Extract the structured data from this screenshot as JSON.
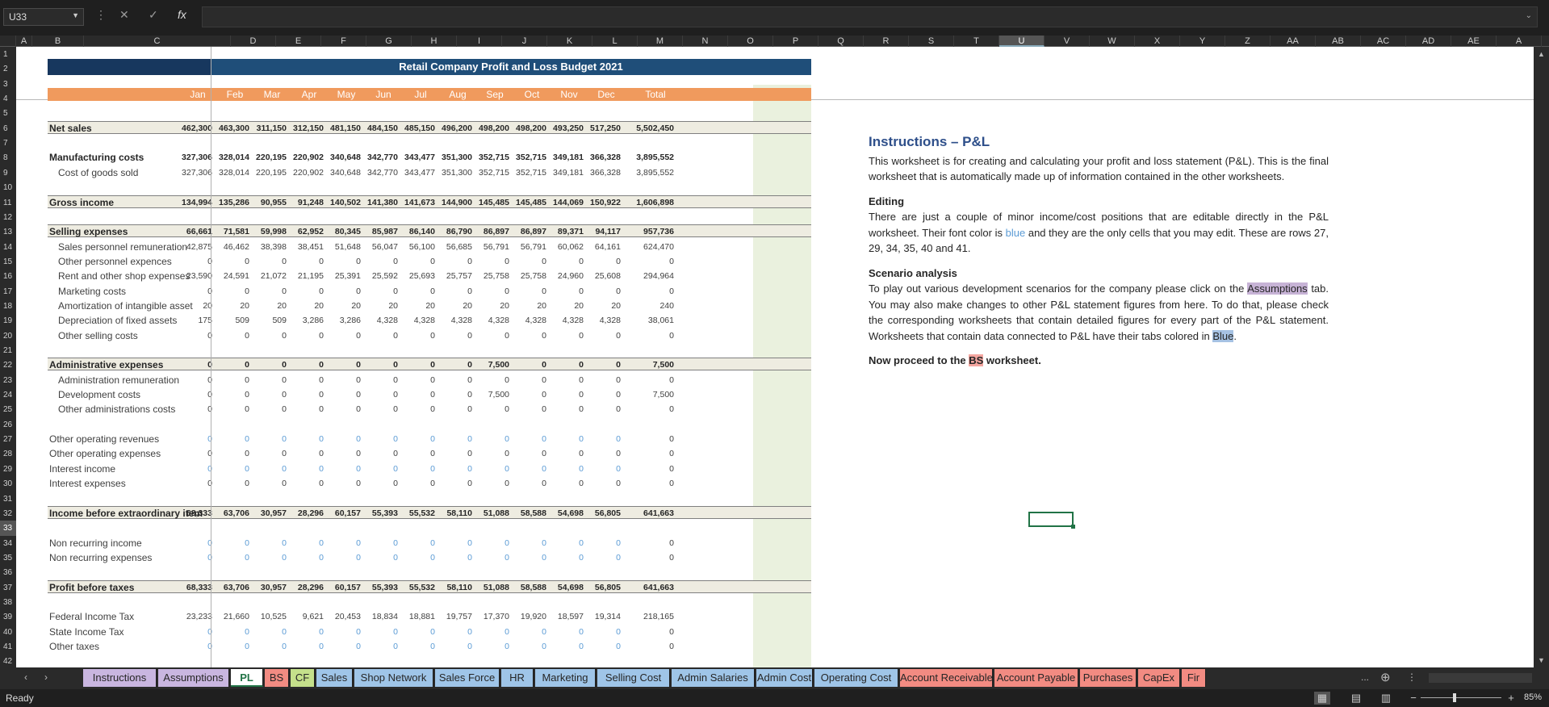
{
  "formula_bar": {
    "name_box": "U33",
    "cancel_icon": "✕",
    "enter_icon": "✓",
    "fx_label": "fx",
    "formula": ""
  },
  "columns": [
    "A",
    "B",
    "C",
    "D",
    "E",
    "F",
    "G",
    "H",
    "I",
    "J",
    "K",
    "L",
    "M",
    "N",
    "O",
    "P",
    "Q",
    "R",
    "S",
    "T",
    "U",
    "V",
    "W",
    "X",
    "Y",
    "Z",
    "AA",
    "AB",
    "AC",
    "AD",
    "AE",
    "A"
  ],
  "selected_column": "U",
  "rows": [
    "1",
    "2",
    "3",
    "4",
    "5",
    "6",
    "7",
    "8",
    "9",
    "10",
    "11",
    "12",
    "13",
    "14",
    "15",
    "16",
    "17",
    "18",
    "19",
    "20",
    "21",
    "22",
    "23",
    "24",
    "25",
    "26",
    "27",
    "28",
    "29",
    "30",
    "31",
    "32",
    "33",
    "34",
    "35",
    "36",
    "37",
    "38",
    "39",
    "40",
    "41",
    "42"
  ],
  "selected_row": "33",
  "sheet": {
    "title": "Retail Company Profit and Loss Budget 2021",
    "months": [
      "Jan",
      "Feb",
      "Mar",
      "Apr",
      "May",
      "Jun",
      "Jul",
      "Aug",
      "Sep",
      "Oct",
      "Nov",
      "Dec",
      "Total"
    ],
    "lines": [
      {
        "row": 6,
        "label": "Net sales",
        "style": "band",
        "values": [
          "462,300",
          "463,300",
          "311,150",
          "312,150",
          "481,150",
          "484,150",
          "485,150",
          "496,200",
          "498,200",
          "498,200",
          "493,250",
          "517,250",
          "5,502,450"
        ]
      },
      {
        "row": 8,
        "label": "Manufacturing costs",
        "style": "bold",
        "values": [
          "327,306",
          "328,014",
          "220,195",
          "220,902",
          "340,648",
          "342,770",
          "343,477",
          "351,300",
          "352,715",
          "352,715",
          "349,181",
          "366,328",
          "3,895,552"
        ]
      },
      {
        "row": 9,
        "label": "Cost of goods sold",
        "style": "sub",
        "values": [
          "327,306",
          "328,014",
          "220,195",
          "220,902",
          "340,648",
          "342,770",
          "343,477",
          "351,300",
          "352,715",
          "352,715",
          "349,181",
          "366,328",
          "3,895,552"
        ]
      },
      {
        "row": 11,
        "label": "Gross income",
        "style": "band",
        "values": [
          "134,994",
          "135,286",
          "90,955",
          "91,248",
          "140,502",
          "141,380",
          "141,673",
          "144,900",
          "145,485",
          "145,485",
          "144,069",
          "150,922",
          "1,606,898"
        ]
      },
      {
        "row": 13,
        "label": "Selling expenses",
        "style": "band",
        "values": [
          "66,661",
          "71,581",
          "59,998",
          "62,952",
          "80,345",
          "85,987",
          "86,140",
          "86,790",
          "86,897",
          "86,897",
          "89,371",
          "94,117",
          "957,736"
        ]
      },
      {
        "row": 14,
        "label": "Sales personnel remuneration",
        "style": "sub",
        "values": [
          "42,875",
          "46,462",
          "38,398",
          "38,451",
          "51,648",
          "56,047",
          "56,100",
          "56,685",
          "56,791",
          "56,791",
          "60,062",
          "64,161",
          "624,470"
        ]
      },
      {
        "row": 15,
        "label": "Other personnel expences",
        "style": "sub",
        "values": [
          "0",
          "0",
          "0",
          "0",
          "0",
          "0",
          "0",
          "0",
          "0",
          "0",
          "0",
          "0",
          "0"
        ]
      },
      {
        "row": 16,
        "label": "Rent and other shop expenses",
        "style": "sub",
        "values": [
          "23,590",
          "24,591",
          "21,072",
          "21,195",
          "25,391",
          "25,592",
          "25,693",
          "25,757",
          "25,758",
          "25,758",
          "24,960",
          "25,608",
          "294,964"
        ]
      },
      {
        "row": 17,
        "label": "Marketing costs",
        "style": "sub",
        "values": [
          "0",
          "0",
          "0",
          "0",
          "0",
          "0",
          "0",
          "0",
          "0",
          "0",
          "0",
          "0",
          "0"
        ]
      },
      {
        "row": 18,
        "label": "Amortization of intangible asset",
        "style": "sub",
        "values": [
          "20",
          "20",
          "20",
          "20",
          "20",
          "20",
          "20",
          "20",
          "20",
          "20",
          "20",
          "20",
          "240"
        ]
      },
      {
        "row": 19,
        "label": "Depreciation of fixed assets",
        "style": "sub",
        "values": [
          "175",
          "509",
          "509",
          "3,286",
          "3,286",
          "4,328",
          "4,328",
          "4,328",
          "4,328",
          "4,328",
          "4,328",
          "4,328",
          "38,061"
        ]
      },
      {
        "row": 20,
        "label": "Other selling costs",
        "style": "sub",
        "values": [
          "0",
          "0",
          "0",
          "0",
          "0",
          "0",
          "0",
          "0",
          "0",
          "0",
          "0",
          "0",
          "0"
        ]
      },
      {
        "row": 22,
        "label": "Administrative expenses",
        "style": "band",
        "values": [
          "0",
          "0",
          "0",
          "0",
          "0",
          "0",
          "0",
          "0",
          "7,500",
          "0",
          "0",
          "0",
          "7,500"
        ]
      },
      {
        "row": 23,
        "label": "Administration remuneration",
        "style": "sub",
        "values": [
          "0",
          "0",
          "0",
          "0",
          "0",
          "0",
          "0",
          "0",
          "0",
          "0",
          "0",
          "0",
          "0"
        ]
      },
      {
        "row": 24,
        "label": "Development costs",
        "style": "sub",
        "values": [
          "0",
          "0",
          "0",
          "0",
          "0",
          "0",
          "0",
          "0",
          "7,500",
          "0",
          "0",
          "0",
          "7,500"
        ]
      },
      {
        "row": 25,
        "label": "Other administrations costs",
        "style": "sub",
        "values": [
          "0",
          "0",
          "0",
          "0",
          "0",
          "0",
          "0",
          "0",
          "0",
          "0",
          "0",
          "0",
          "0"
        ]
      },
      {
        "row": 27,
        "label": "Other operating revenues",
        "style": "blue",
        "values": [
          "0",
          "0",
          "0",
          "0",
          "0",
          "0",
          "0",
          "0",
          "0",
          "0",
          "0",
          "0",
          "0"
        ]
      },
      {
        "row": 28,
        "label": "Other operating expenses",
        "style": "plain",
        "values": [
          "0",
          "0",
          "0",
          "0",
          "0",
          "0",
          "0",
          "0",
          "0",
          "0",
          "0",
          "0",
          "0"
        ]
      },
      {
        "row": 29,
        "label": "Interest income",
        "style": "blue",
        "values": [
          "0",
          "0",
          "0",
          "0",
          "0",
          "0",
          "0",
          "0",
          "0",
          "0",
          "0",
          "0",
          "0"
        ]
      },
      {
        "row": 30,
        "label": "Interest expenses",
        "style": "plain",
        "values": [
          "0",
          "0",
          "0",
          "0",
          "0",
          "0",
          "0",
          "0",
          "0",
          "0",
          "0",
          "0",
          "0"
        ]
      },
      {
        "row": 32,
        "label": "Income before extraordinary item",
        "style": "band",
        "values": [
          "68,333",
          "63,706",
          "30,957",
          "28,296",
          "60,157",
          "55,393",
          "55,532",
          "58,110",
          "51,088",
          "58,588",
          "54,698",
          "56,805",
          "641,663"
        ]
      },
      {
        "row": 34,
        "label": "Non recurring income",
        "style": "blue",
        "values": [
          "0",
          "0",
          "0",
          "0",
          "0",
          "0",
          "0",
          "0",
          "0",
          "0",
          "0",
          "0",
          "0"
        ]
      },
      {
        "row": 35,
        "label": "Non recurring expenses",
        "style": "blue",
        "values": [
          "0",
          "0",
          "0",
          "0",
          "0",
          "0",
          "0",
          "0",
          "0",
          "0",
          "0",
          "0",
          "0"
        ]
      },
      {
        "row": 37,
        "label": "Profit before taxes",
        "style": "band",
        "values": [
          "68,333",
          "63,706",
          "30,957",
          "28,296",
          "60,157",
          "55,393",
          "55,532",
          "58,110",
          "51,088",
          "58,588",
          "54,698",
          "56,805",
          "641,663"
        ]
      },
      {
        "row": 39,
        "label": "Federal Income Tax",
        "style": "plain",
        "values": [
          "23,233",
          "21,660",
          "10,525",
          "9,621",
          "20,453",
          "18,834",
          "18,881",
          "19,757",
          "17,370",
          "19,920",
          "18,597",
          "19,314",
          "218,165"
        ]
      },
      {
        "row": 40,
        "label": "State Income Tax",
        "style": "blue",
        "values": [
          "0",
          "0",
          "0",
          "0",
          "0",
          "0",
          "0",
          "0",
          "0",
          "0",
          "0",
          "0",
          "0"
        ]
      },
      {
        "row": 41,
        "label": "Other taxes",
        "style": "blue",
        "values": [
          "0",
          "0",
          "0",
          "0",
          "0",
          "0",
          "0",
          "0",
          "0",
          "0",
          "0",
          "0",
          "0"
        ]
      }
    ]
  },
  "instructions": {
    "title": "Instructions – P&L",
    "intro": "This worksheet is for creating and calculating your profit and loss statement (P&L). This is the final worksheet that is automatically made up of information contained in the other worksheets.",
    "editing_heading": "Editing",
    "editing_p1": "There are just a couple of minor income/cost positions that are editable directly in the P&L worksheet. Their font color is ",
    "editing_blue": "blue",
    "editing_p2": " and they are the only cells that you may edit. These are rows 27, 29, 34, 35, 40 and 41.",
    "scenario_heading": "Scenario analysis",
    "scenario_p1": "To play out various development scenarios for the company please click on the ",
    "scenario_assumptions": "Assumptions",
    "scenario_p2": " tab.  You may also make changes to other P&L statement figures from here. To do that, please check the corresponding worksheets that contain detailed figures for every part of the P&L statement. Worksheets that contain data connected to P&L have their tabs colored in ",
    "scenario_blue": "Blue",
    "scenario_end": ".",
    "proceed_p1": "Now proceed to the ",
    "proceed_bs": "BS",
    "proceed_p2": " worksheet."
  },
  "tabs": [
    {
      "label": "Instructions",
      "color": "#c9b6e0"
    },
    {
      "label": "Assumptions",
      "color": "#c9b6e0"
    },
    {
      "label": "PL",
      "color": "#ffffff",
      "active": true
    },
    {
      "label": "BS",
      "color": "#f28b82"
    },
    {
      "label": "CF",
      "color": "#c5e08b"
    },
    {
      "label": "Sales",
      "color": "#9fc5e8"
    },
    {
      "label": "Shop Network",
      "color": "#9fc5e8"
    },
    {
      "label": "Sales Force",
      "color": "#9fc5e8"
    },
    {
      "label": "HR",
      "color": "#9fc5e8"
    },
    {
      "label": "Marketing",
      "color": "#9fc5e8"
    },
    {
      "label": "Selling Cost",
      "color": "#9fc5e8"
    },
    {
      "label": "Admin Salaries",
      "color": "#9fc5e8"
    },
    {
      "label": "Admin Cost",
      "color": "#9fc5e8"
    },
    {
      "label": "Operating Cost",
      "color": "#9fc5e8"
    },
    {
      "label": "Account Receivable",
      "color": "#f28b82"
    },
    {
      "label": "Account Payable",
      "color": "#f28b82"
    },
    {
      "label": "Purchases",
      "color": "#f28b82"
    },
    {
      "label": "CapEx",
      "color": "#f28b82"
    },
    {
      "label": "Fir",
      "color": "#f28b82"
    }
  ],
  "tab_nav": {
    "prev": "‹",
    "next": "›",
    "more": "...",
    "add": "⊕",
    "options": "⋮"
  },
  "status": {
    "ready": "Ready",
    "zoom": "85%"
  }
}
